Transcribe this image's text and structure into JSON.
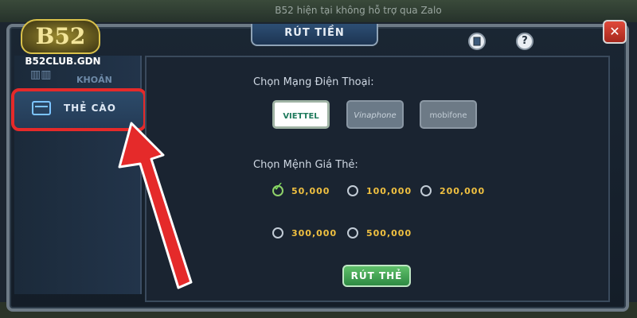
{
  "notice": "B52 hiện tại không hỗ trợ qua Zalo",
  "logo": {
    "brand": "B52",
    "site": "B52CLUB.GDN"
  },
  "dialog": {
    "title": "RÚT TIỀN"
  },
  "buttons": {
    "help_label": "?",
    "close_label": "✕",
    "submit_label": "RÚT THẺ"
  },
  "sidebar": {
    "items": [
      {
        "label": "KHOẢN",
        "active": false
      },
      {
        "label": "THẺ CÀO",
        "active": true
      }
    ]
  },
  "form": {
    "carrier_label": "Chọn Mạng Điện Thoại:",
    "carriers": [
      {
        "name": "VIETTEL",
        "selected": true
      },
      {
        "name": "Vinaphone",
        "selected": false
      },
      {
        "name": "mobifone",
        "selected": false
      }
    ],
    "denomination_label": "Chọn Mệnh Giá Thẻ:",
    "denominations": [
      {
        "value": "50,000",
        "selected": true
      },
      {
        "value": "100,000",
        "selected": false
      },
      {
        "value": "200,000",
        "selected": false
      },
      {
        "value": "300,000",
        "selected": false
      },
      {
        "value": "500,000",
        "selected": false
      }
    ]
  },
  "colors": {
    "highlight": "#e52a2a",
    "accent_gold": "#f0c040",
    "submit_green": "#3fa652"
  }
}
